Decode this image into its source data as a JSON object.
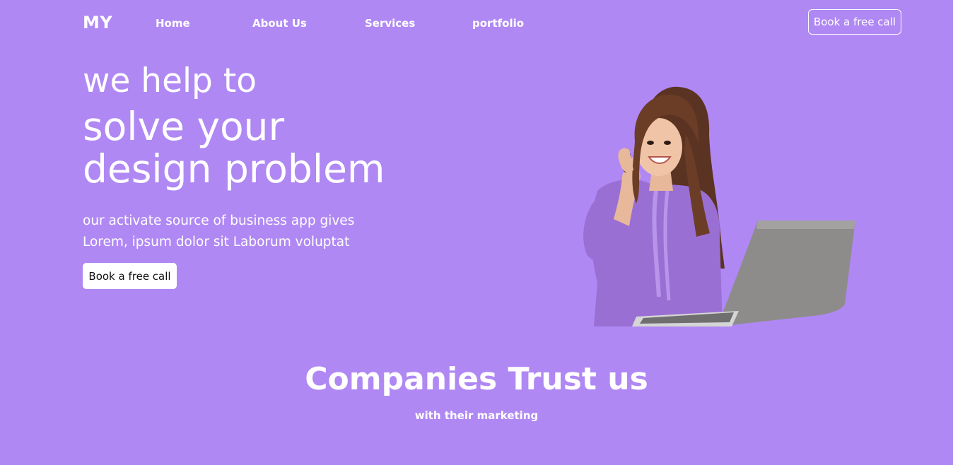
{
  "header": {
    "brand": "MY",
    "nav": {
      "home": "Home",
      "about": "About Us",
      "services": "Services",
      "portfolio": "portfolio"
    },
    "cta_label": "Book a free call"
  },
  "hero": {
    "line1": "we help to",
    "line2": "solve your",
    "line3": "design problem",
    "desc_line1": "our activate source of business app gives",
    "desc_line2": "Lorem, ipsum dolor sit Laborum voluptat",
    "cta_label": "Book a free call",
    "image_subject": "woman-on-phone-with-laptop"
  },
  "trust": {
    "title": "Companies Trust us",
    "subtitle": "with their marketing"
  },
  "colors": {
    "background": "#b088f4",
    "text": "#ffffff",
    "button_bg": "#ffffff",
    "button_text": "#111111"
  }
}
